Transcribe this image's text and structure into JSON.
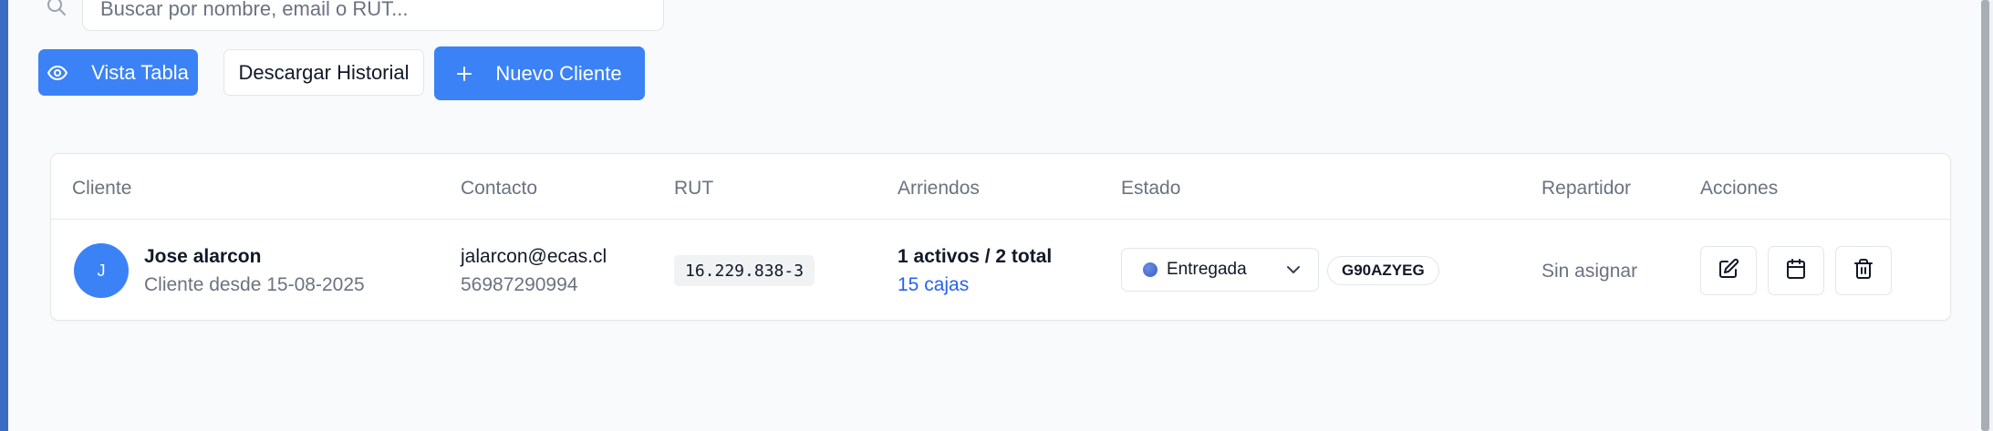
{
  "search": {
    "placeholder": "Buscar por nombre, email o RUT...",
    "value": "",
    "icon": "search-icon"
  },
  "toolbar": {
    "view_label": "Vista Tabla",
    "view_icon": "eye-icon",
    "download_label": "Descargar Historial",
    "new_label": "Nuevo Cliente",
    "new_icon": "plus-icon"
  },
  "table": {
    "columns": [
      "Cliente",
      "Contacto",
      "RUT",
      "Arriendos",
      "Estado",
      "Repartidor",
      "Acciones"
    ],
    "rows": [
      {
        "avatar_initial": "J",
        "name": "Jose alarcon",
        "since": "Cliente desde 15-08-2025",
        "email": "jalarcon@ecas.cl",
        "phone": "56987290994",
        "rut": "16.229.838-3",
        "rentals": "1 activos / 2 total",
        "boxes": "15 cajas",
        "status": "Entregada",
        "code": "G90AZYEG",
        "driver": "Sin asignar",
        "actions": [
          "edit-icon",
          "calendar-icon",
          "trash-icon"
        ]
      }
    ]
  },
  "colors": {
    "accent": "#3b82f6",
    "link": "#2563eb",
    "status_dot": "#3a5fc0",
    "left_strip": "#3b6cc4"
  }
}
